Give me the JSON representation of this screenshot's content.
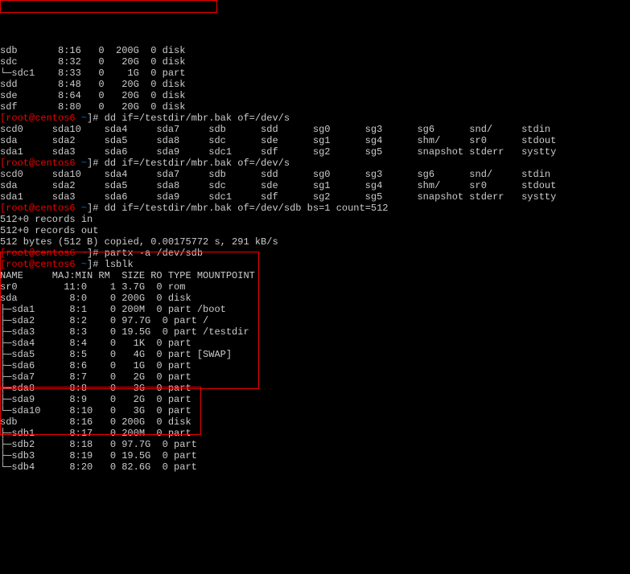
{
  "top_block": [
    "sdb       8:16   0  200G  0 disk ",
    "sdc       8:32   0   20G  0 disk ",
    "└─sdc1    8:33   0    1G  0 part ",
    "sdd       8:48   0   20G  0 disk ",
    "sde       8:64   0   20G  0 disk ",
    "sdf       8:80   0   20G  0 disk "
  ],
  "prompt_user": "[root@centos6 ",
  "prompt_path": "~",
  "prompt_tail": "]# ",
  "cmd1": "dd if=/testdir/mbr.bak of=/dev/s",
  "tab1_rows": [
    "scd0     sda10    sda4     sda7     sdb      sdd      sg0      sg3      sg6      snd/     stdin",
    "sda      sda2     sda5     sda8     sdc      sde      sg1      sg4      shm/     sr0      stdout",
    "sda1     sda3     sda6     sda9     sdc1     sdf      sg2      sg5      snapshot stderr   systty"
  ],
  "cmd2": "dd if=/testdir/mbr.bak of=/dev/s",
  "tab2_rows": [
    "scd0     sda10    sda4     sda7     sdb      sdd      sg0      sg3      sg6      snd/     stdin",
    "sda      sda2     sda5     sda8     sdc      sde      sg1      sg4      shm/     sr0      stdout",
    "sda1     sda3     sda6     sda9     sdc1     sdf      sg2      sg5      snapshot stderr   systty"
  ],
  "cmd3": "dd if=/testdir/mbr.bak of=/dev/sdb bs=1 count=512",
  "dd_out": [
    "512+0 records in",
    "512+0 records out",
    "512 bytes (512 B) copied, 0.00175772 s, 291 kB/s"
  ],
  "cmd4": "partx -a /dev/sdb",
  "cmd5": "lsblk",
  "lsblk_header": "NAME     MAJ:MIN RM  SIZE RO TYPE MOUNTPOINT",
  "lsblk_rows": [
    "sr0        11:0    1 3.7G  0 rom  ",
    "sda         8:0    0 200G  0 disk ",
    "├─sda1      8:1    0 200M  0 part /boot",
    "├─sda2      8:2    0 97.7G  0 part /",
    "├─sda3      8:3    0 19.5G  0 part /testdir",
    "├─sda4      8:4    0   1K  0 part ",
    "├─sda5      8:5    0   4G  0 part [SWAP]",
    "├─sda6      8:6    0   1G  0 part ",
    "├─sda7      8:7    0   2G  0 part ",
    "├─sda8      8:8    0   3G  0 part ",
    "├─sda9      8:9    0   2G  0 part ",
    "└─sda10     8:10   0   3G  0 part ",
    "sdb         8:16   0 200G  0 disk ",
    "├─sdb1      8:17   0 200M  0 part ",
    "├─sdb2      8:18   0 97.7G  0 part ",
    "├─sdb3      8:19   0 19.5G  0 part ",
    "└─sdb4      8:20   0 82.6G  0 part "
  ]
}
